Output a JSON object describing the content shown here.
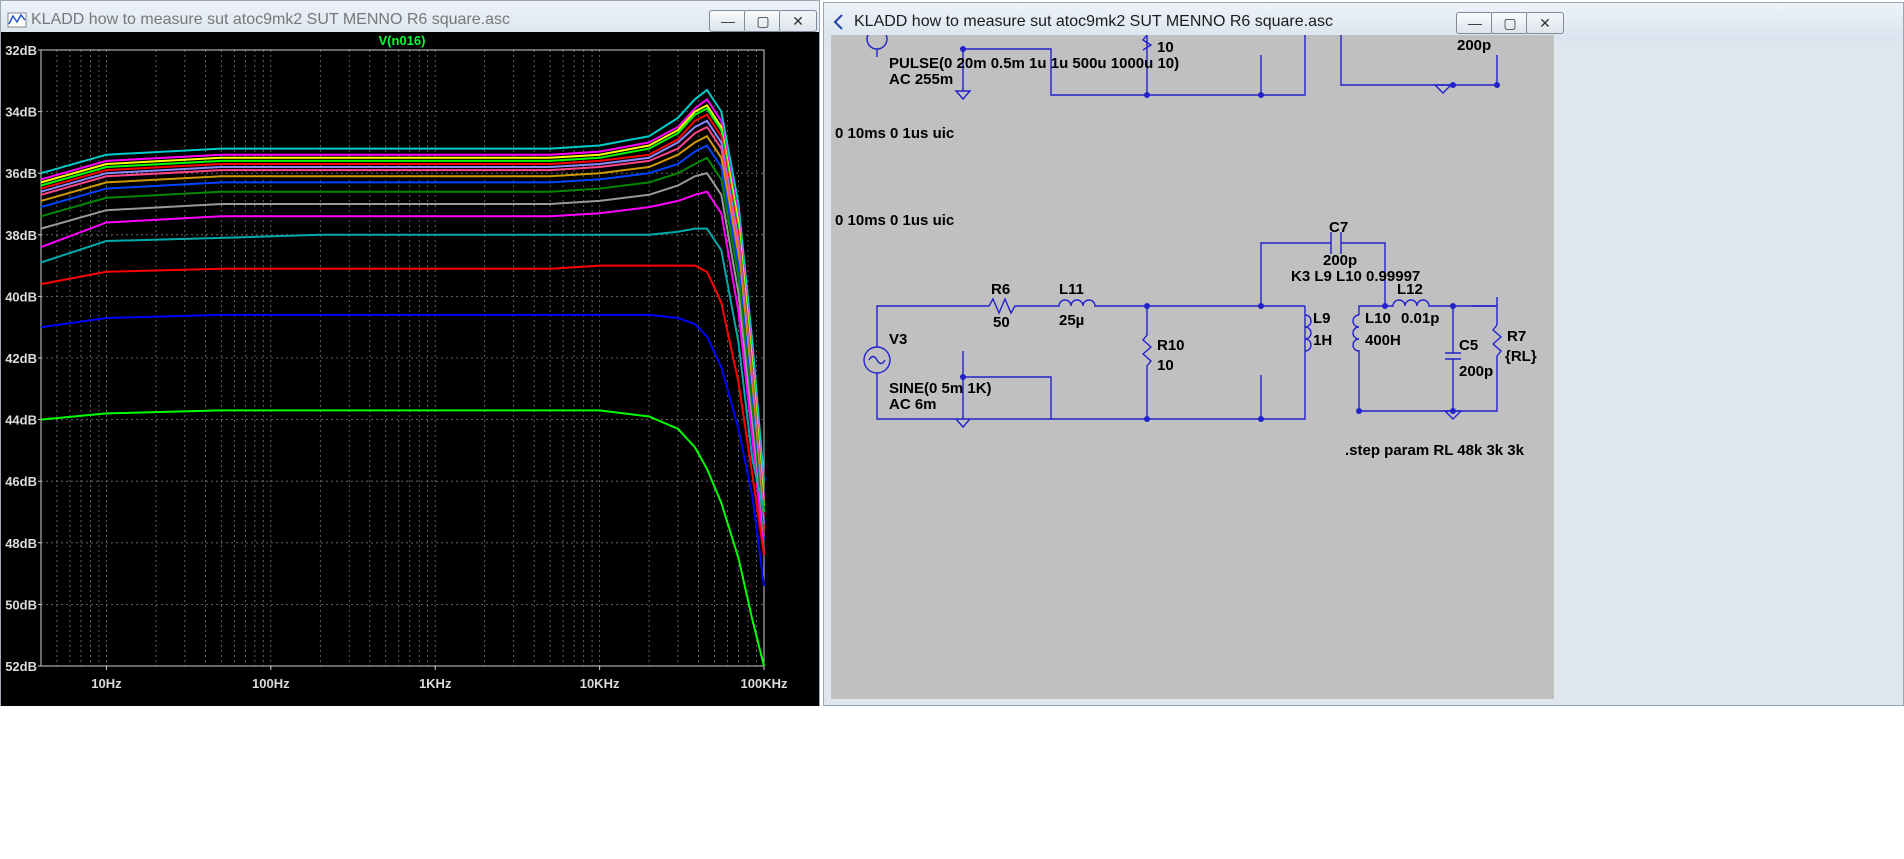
{
  "window_left": {
    "title": "KLADD how to measure sut atoc9mk2 SUT MENNO R6 square.asc",
    "trace_label": "V(n016)",
    "buttons": {
      "minimize": "—",
      "maximize": "▢",
      "close": "✕"
    }
  },
  "window_right": {
    "title": "KLADD how to measure sut atoc9mk2 SUT MENNO R6 square.asc",
    "buttons": {
      "minimize": "—",
      "maximize": "▢",
      "close": "✕"
    }
  },
  "chart_data": {
    "type": "line",
    "title": "V(n016)",
    "xlabel": "",
    "ylabel": "",
    "x_scale": "log",
    "xlim": [
      4,
      100000
    ],
    "ylim": [
      -52,
      -32
    ],
    "grid": true,
    "x_tick_labels": [
      "10Hz",
      "100Hz",
      "1KHz",
      "10KHz",
      "100KHz"
    ],
    "x_tick_values": [
      10,
      100,
      1000,
      10000,
      100000
    ],
    "y_tick_labels": [
      "32dB",
      "34dB",
      "36dB",
      "38dB",
      "40dB",
      "42dB",
      "44dB",
      "46dB",
      "48dB",
      "50dB",
      "52dB"
    ],
    "y_tick_values": [
      -32,
      -34,
      -36,
      -38,
      -40,
      -42,
      -44,
      -46,
      -48,
      -50,
      -52
    ],
    "x": [
      4,
      10,
      50,
      200,
      1000,
      5000,
      10000,
      20000,
      30000,
      38000,
      45000,
      55000,
      70000,
      85000,
      100000
    ],
    "series": [
      {
        "color": "#00cccc",
        "values": [
          -36.0,
          -35.4,
          -35.2,
          -35.2,
          -35.2,
          -35.2,
          -35.1,
          -34.8,
          -34.2,
          -33.6,
          -33.3,
          -34.0,
          -37.0,
          -41.5,
          -46.0
        ]
      },
      {
        "color": "#ff00ff",
        "values": [
          -36.2,
          -35.6,
          -35.4,
          -35.4,
          -35.4,
          -35.4,
          -35.3,
          -35.0,
          -34.5,
          -33.9,
          -33.6,
          -34.3,
          -37.4,
          -42.0,
          -46.6
        ]
      },
      {
        "color": "#ffff00",
        "values": [
          -36.3,
          -35.7,
          -35.5,
          -35.5,
          -35.5,
          -35.5,
          -35.4,
          -35.1,
          -34.6,
          -34.0,
          -33.8,
          -34.5,
          -37.6,
          -42.2,
          -46.8
        ]
      },
      {
        "color": "#00ff00",
        "values": [
          -36.4,
          -35.8,
          -35.6,
          -35.6,
          -35.6,
          -35.6,
          -35.5,
          -35.2,
          -34.7,
          -34.1,
          -33.9,
          -34.6,
          -37.8,
          -42.4,
          -47.0
        ]
      },
      {
        "color": "#ff0000",
        "values": [
          -36.5,
          -35.9,
          -35.7,
          -35.7,
          -35.7,
          -35.7,
          -35.6,
          -35.4,
          -34.9,
          -34.3,
          -34.1,
          -34.8,
          -38.0,
          -42.6,
          -47.2
        ]
      },
      {
        "color": "#8888ff",
        "values": [
          -36.6,
          -36.0,
          -35.8,
          -35.8,
          -35.8,
          -35.8,
          -35.7,
          -35.5,
          -35.0,
          -34.5,
          -34.3,
          -35.0,
          -38.2,
          -42.8,
          -47.4
        ]
      },
      {
        "color": "#ff4488",
        "values": [
          -36.7,
          -36.1,
          -35.9,
          -35.9,
          -35.9,
          -35.9,
          -35.8,
          -35.6,
          -35.2,
          -34.7,
          -34.5,
          -35.2,
          -38.4,
          -43.0,
          -47.6
        ]
      },
      {
        "color": "#cc9900",
        "values": [
          -36.9,
          -36.3,
          -36.1,
          -36.1,
          -36.1,
          -36.1,
          -36.0,
          -35.8,
          -35.4,
          -35.0,
          -34.8,
          -35.5,
          -38.7,
          -43.2,
          -47.8
        ]
      },
      {
        "color": "#0044ff",
        "values": [
          -37.1,
          -36.5,
          -36.3,
          -36.3,
          -36.3,
          -36.3,
          -36.2,
          -36.0,
          -35.7,
          -35.3,
          -35.1,
          -35.8,
          -39.0,
          -43.5,
          -48.0
        ]
      },
      {
        "color": "#008800",
        "values": [
          -37.4,
          -36.8,
          -36.6,
          -36.6,
          -36.6,
          -36.6,
          -36.5,
          -36.3,
          -36.0,
          -35.7,
          -35.5,
          -36.2,
          -39.4,
          -43.8,
          -48.2
        ]
      },
      {
        "color": "#999999",
        "values": [
          -37.8,
          -37.2,
          -37.0,
          -37.0,
          -37.0,
          -37.0,
          -36.9,
          -36.7,
          -36.4,
          -36.1,
          -36.0,
          -36.7,
          -39.9,
          -44.2,
          -48.3
        ]
      },
      {
        "color": "#ff00ff",
        "values": [
          -38.4,
          -37.6,
          -37.4,
          -37.4,
          -37.4,
          -37.4,
          -37.3,
          -37.1,
          -36.9,
          -36.7,
          -36.6,
          -37.3,
          -40.5,
          -44.6,
          -48.4
        ]
      },
      {
        "color": "#00aaaa",
        "values": [
          -38.9,
          -38.2,
          -38.1,
          -38.0,
          -38.0,
          -38.0,
          -38.0,
          -38.0,
          -37.9,
          -37.8,
          -37.8,
          -38.5,
          -41.5,
          -45.3,
          -47.0
        ]
      },
      {
        "color": "#ff0000",
        "values": [
          -39.6,
          -39.2,
          -39.1,
          -39.1,
          -39.1,
          -39.1,
          -39.0,
          -39.0,
          -39.0,
          -39.0,
          -39.2,
          -40.2,
          -42.8,
          -45.8,
          -48.4
        ]
      },
      {
        "color": "#0000ff",
        "values": [
          -41.0,
          -40.7,
          -40.6,
          -40.6,
          -40.6,
          -40.6,
          -40.6,
          -40.6,
          -40.7,
          -40.9,
          -41.3,
          -42.3,
          -44.3,
          -46.5,
          -49.4
        ]
      },
      {
        "color": "#00ff00",
        "values": [
          -44.0,
          -43.8,
          -43.7,
          -43.7,
          -43.7,
          -43.7,
          -43.7,
          -43.9,
          -44.3,
          -44.9,
          -45.6,
          -46.7,
          -48.5,
          -50.5,
          -52.0
        ]
      }
    ]
  },
  "schematic": {
    "top_netlist_1": "PULSE(0 20m 0.5m 1u 1u 500u 1000u 10)",
    "top_netlist_2": "AC 255m",
    "top_r_value": "10",
    "top_c_value": "200p",
    "tran1": "0 10ms 0 1us uic",
    "tran2": "0 10ms 0 1us uic",
    "c7_name": "C7",
    "c7_value": "200p",
    "k3": "K3 L9 L10 0.99997",
    "r6_name": "R6",
    "r6_value": "50",
    "l11_name": "L11",
    "l11_value": "25µ",
    "v3_name": "V3",
    "v3_value1": "SINE(0 5m 1K)",
    "v3_value2": "AC 6m",
    "r10_name": "R10",
    "r10_value": "10",
    "l9_name": "L9",
    "l9_value": "1H",
    "l10_name": "L10",
    "l10_value": "400H",
    "l12_name": "L12",
    "l12_value": "0.01p",
    "c5_name": "C5",
    "c5_value": "200p",
    "r7_name": "R7",
    "r7_value": "{RL}",
    "step": ".step param RL 48k 3k 3k"
  }
}
